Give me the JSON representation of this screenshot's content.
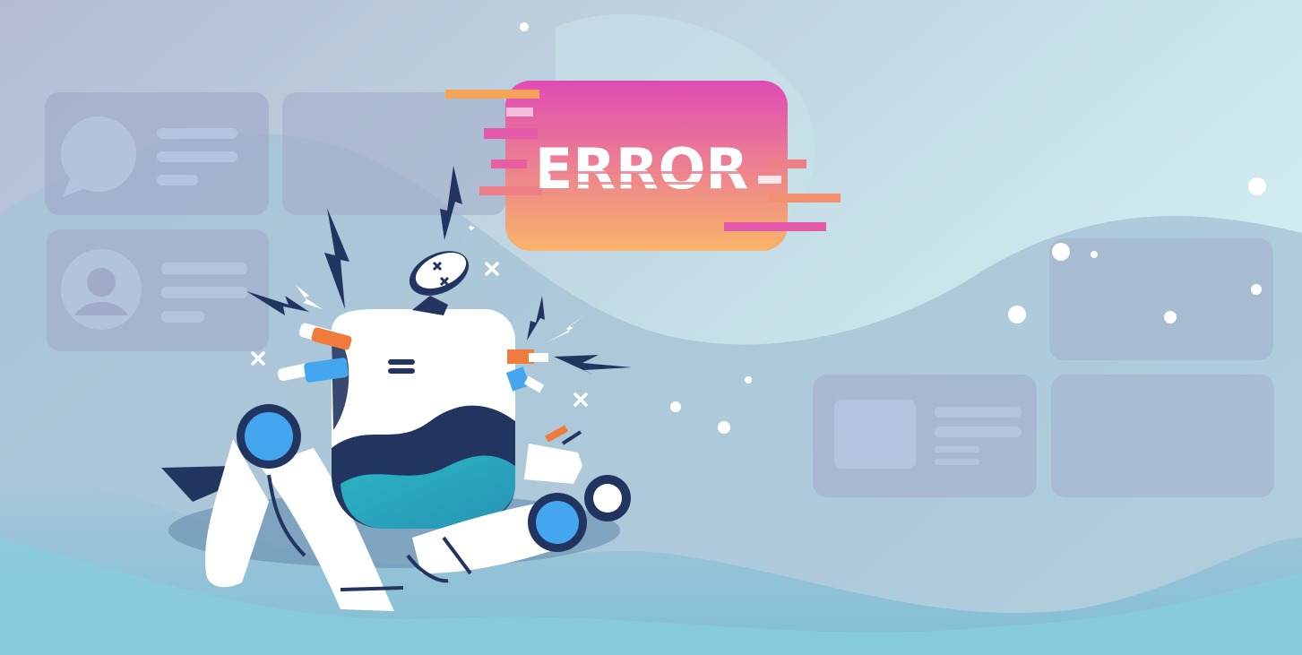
{
  "error_badge": {
    "label": "ERROR"
  },
  "colors": {
    "bg_top_left": "#b3bbd3",
    "bg_top_right": "#cfeff3",
    "bg_bottom": "#8ec9dc",
    "card_fill": "#a0abc7",
    "badge_top": "#e04bb6",
    "badge_bottom": "#f8b46a",
    "robot_white": "#ffffff",
    "robot_navy": "#223561",
    "robot_teal": "#2bb7c4",
    "robot_blue": "#43a6ef",
    "robot_orange": "#ef7b3d"
  },
  "decorations": {
    "background_cards": [
      "profile-card",
      "blank-card",
      "user-card",
      "right-card-top",
      "right-card-image",
      "right-card-blank"
    ],
    "icons": [
      "lightning-icon",
      "sparkle-x-icon",
      "dizzy-eyes-icon"
    ]
  }
}
